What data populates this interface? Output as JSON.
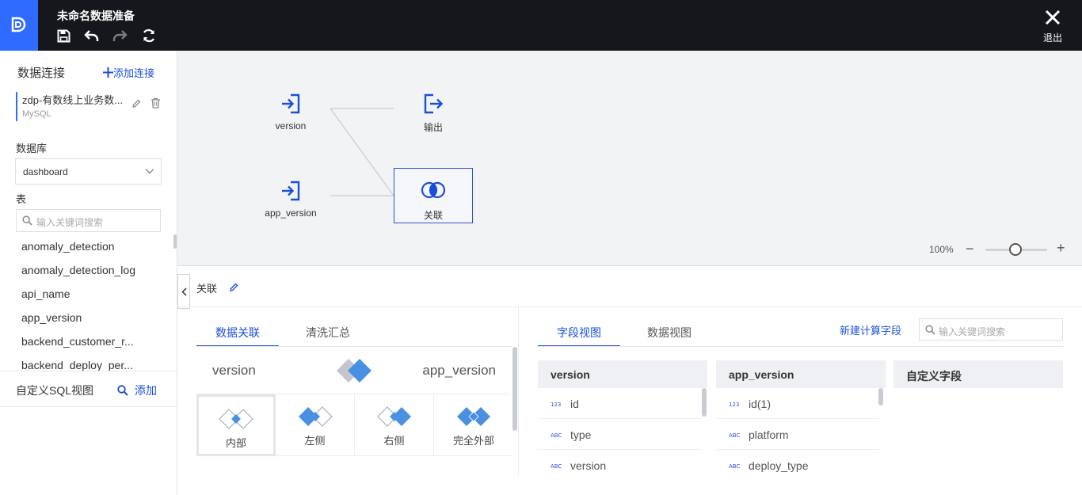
{
  "window": {
    "title": "未命名数据准备",
    "exit_label": "退出"
  },
  "sidebar": {
    "title": "数据连接",
    "add_connection": "添加连接",
    "connection": {
      "name": "zdp-有数线上业务数...",
      "type": "MySQL"
    },
    "database_label": "数据库",
    "database_value": "dashboard",
    "table_label": "表",
    "search_placeholder": "输入关键词搜索",
    "tables": [
      "anomaly_detection",
      "anomaly_detection_log",
      "api_name",
      "app_version",
      "backend_customer_r...",
      "backend_deploy_per..."
    ],
    "sql_view_label": "自定义SQL视图",
    "sql_add": "添加"
  },
  "canvas": {
    "nodes": {
      "version": "version",
      "output": "输出",
      "app_version": "app_version",
      "join": "关联"
    },
    "zoom": "100%"
  },
  "panel": {
    "title": "关联",
    "left_tabs": [
      "数据关联",
      "清洗汇总"
    ],
    "join_left": "version",
    "join_right": "app_version",
    "join_types": [
      "内部",
      "左侧",
      "右侧",
      "完全外部"
    ],
    "right_tabs": [
      "字段视图",
      "数据视图"
    ],
    "new_calc_field": "新建计算字段",
    "search_placeholder": "输入关键词搜索",
    "columns": [
      {
        "title": "version",
        "fields": [
          {
            "type": "123",
            "name": "id"
          },
          {
            "type": "ABC",
            "name": "type"
          },
          {
            "type": "ABC",
            "name": "version"
          }
        ]
      },
      {
        "title": "app_version",
        "fields": [
          {
            "type": "123",
            "name": "id(1)"
          },
          {
            "type": "ABC",
            "name": "platform"
          },
          {
            "type": "ABC",
            "name": "deploy_type"
          }
        ]
      },
      {
        "title": "自定义字段",
        "fields": []
      }
    ]
  },
  "colors": {
    "accent": "#1a4fd6",
    "topbar": "#15171c",
    "logo": "#2f6bff",
    "join_fill": "#4a90e2"
  }
}
